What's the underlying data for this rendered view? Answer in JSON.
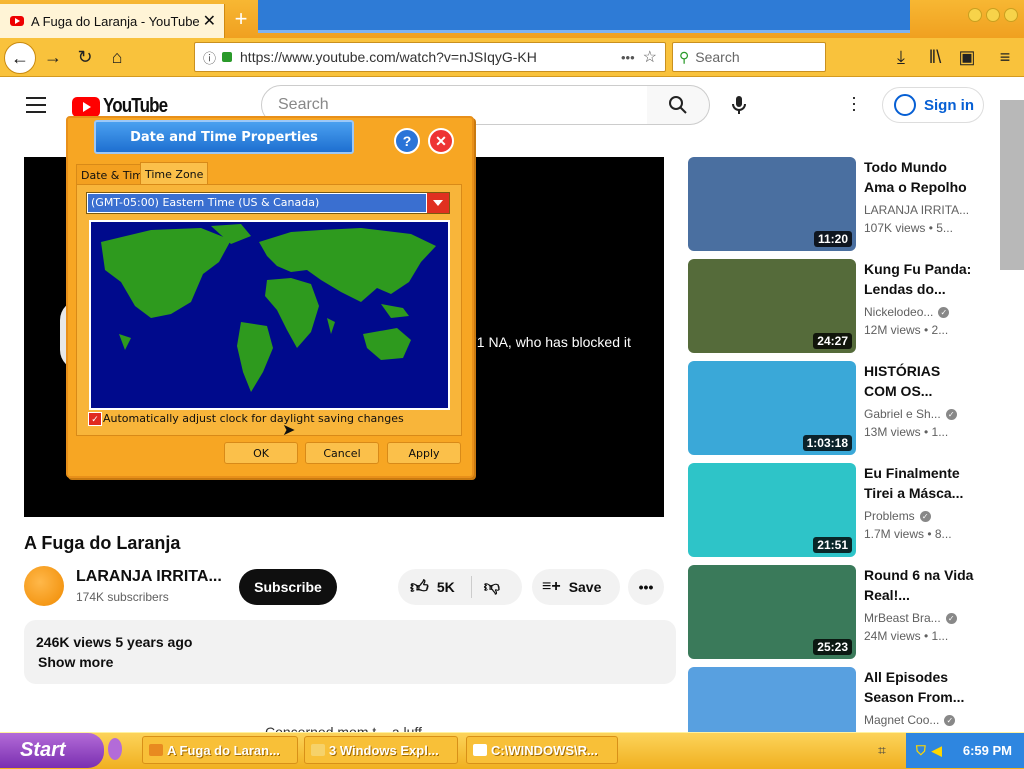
{
  "browser": {
    "tab_title": "A Fuga do Laranja - YouTube",
    "tab_close": "✕",
    "new_tab": "+",
    "url": "https://www.youtube.com/watch?v=nJSIqyG-KH",
    "search_placeholder": "Search",
    "url_more": "•••"
  },
  "youtube": {
    "logo_text": "YouTube",
    "search_placeholder": "Search",
    "sign_in": "Sign in",
    "player_message": "71 NA, who has blocked it",
    "video_title": "A Fuga do Laranja",
    "channel_name": "LARANJA IRRITA...",
    "subscribers": "174K subscribers",
    "subscribe": "Subscribe",
    "likes": "5K",
    "save": "Save",
    "views_date": "246K views  5 years ago",
    "show_more": "Show more",
    "partial_text": "Concerned mom t... a luff..."
  },
  "recommendations": [
    {
      "title": "Todo Mundo Ama o Repolho",
      "channel": "LARANJA IRRITA...",
      "verified": false,
      "views": "107K views  •  5...",
      "duration": "11:20",
      "thumb_color": "#4a6fa0"
    },
    {
      "title": "Kung Fu Panda: Lendas do...",
      "channel": "Nickelodeo...",
      "verified": true,
      "views": "12M views  •  2...",
      "duration": "24:27",
      "thumb_color": "#556b3a"
    },
    {
      "title": "HISTÓRIAS COM OS...",
      "channel": "Gabriel e Sh...",
      "verified": true,
      "views": "13M views  •  1...",
      "duration": "1:03:18",
      "thumb_color": "#3aa8d8"
    },
    {
      "title": "Eu Finalmente Tirei a Másca...",
      "channel": "Problems",
      "verified": true,
      "views": "1.7M views  •  8...",
      "duration": "21:51",
      "thumb_color": "#2ec4c8"
    },
    {
      "title": "Round 6 na Vida Real!...",
      "channel": "MrBeast Bra...",
      "verified": true,
      "views": "24M views  •  1...",
      "duration": "25:23",
      "thumb_color": "#3a7a5a"
    },
    {
      "title": "All Episodes Season From...",
      "channel": "Magnet Coo...",
      "verified": true,
      "views": "",
      "duration": "",
      "thumb_color": "#58a0e0"
    }
  ],
  "dialog": {
    "title": "Date and Time Properties",
    "help": "?",
    "close": "✕",
    "tab_date_time": "Date & Time",
    "tab_time_zone": "Time Zone",
    "timezone": "(GMT-05:00) Eastern Time (US & Canada)",
    "dst_label": "Automatically adjust clock for daylight saving changes",
    "dst_checked": "✓",
    "ok": "OK",
    "cancel": "Cancel",
    "apply": "Apply"
  },
  "taskbar": {
    "start": "Start",
    "tasks": [
      {
        "label": "A Fuga do Laran..."
      },
      {
        "label": "3 Windows Expl..."
      },
      {
        "label": "C:\\WINDOWS\\R..."
      }
    ],
    "clock": "6:59 PM"
  },
  "colors": {
    "youtube_red": "#ff0000",
    "sign_in_blue": "#065fd4",
    "map_ocean": "#000a8c",
    "map_land": "#2e9a1e",
    "taskbar_gold": "#f0b020",
    "start_purple": "#7a2fb0"
  }
}
